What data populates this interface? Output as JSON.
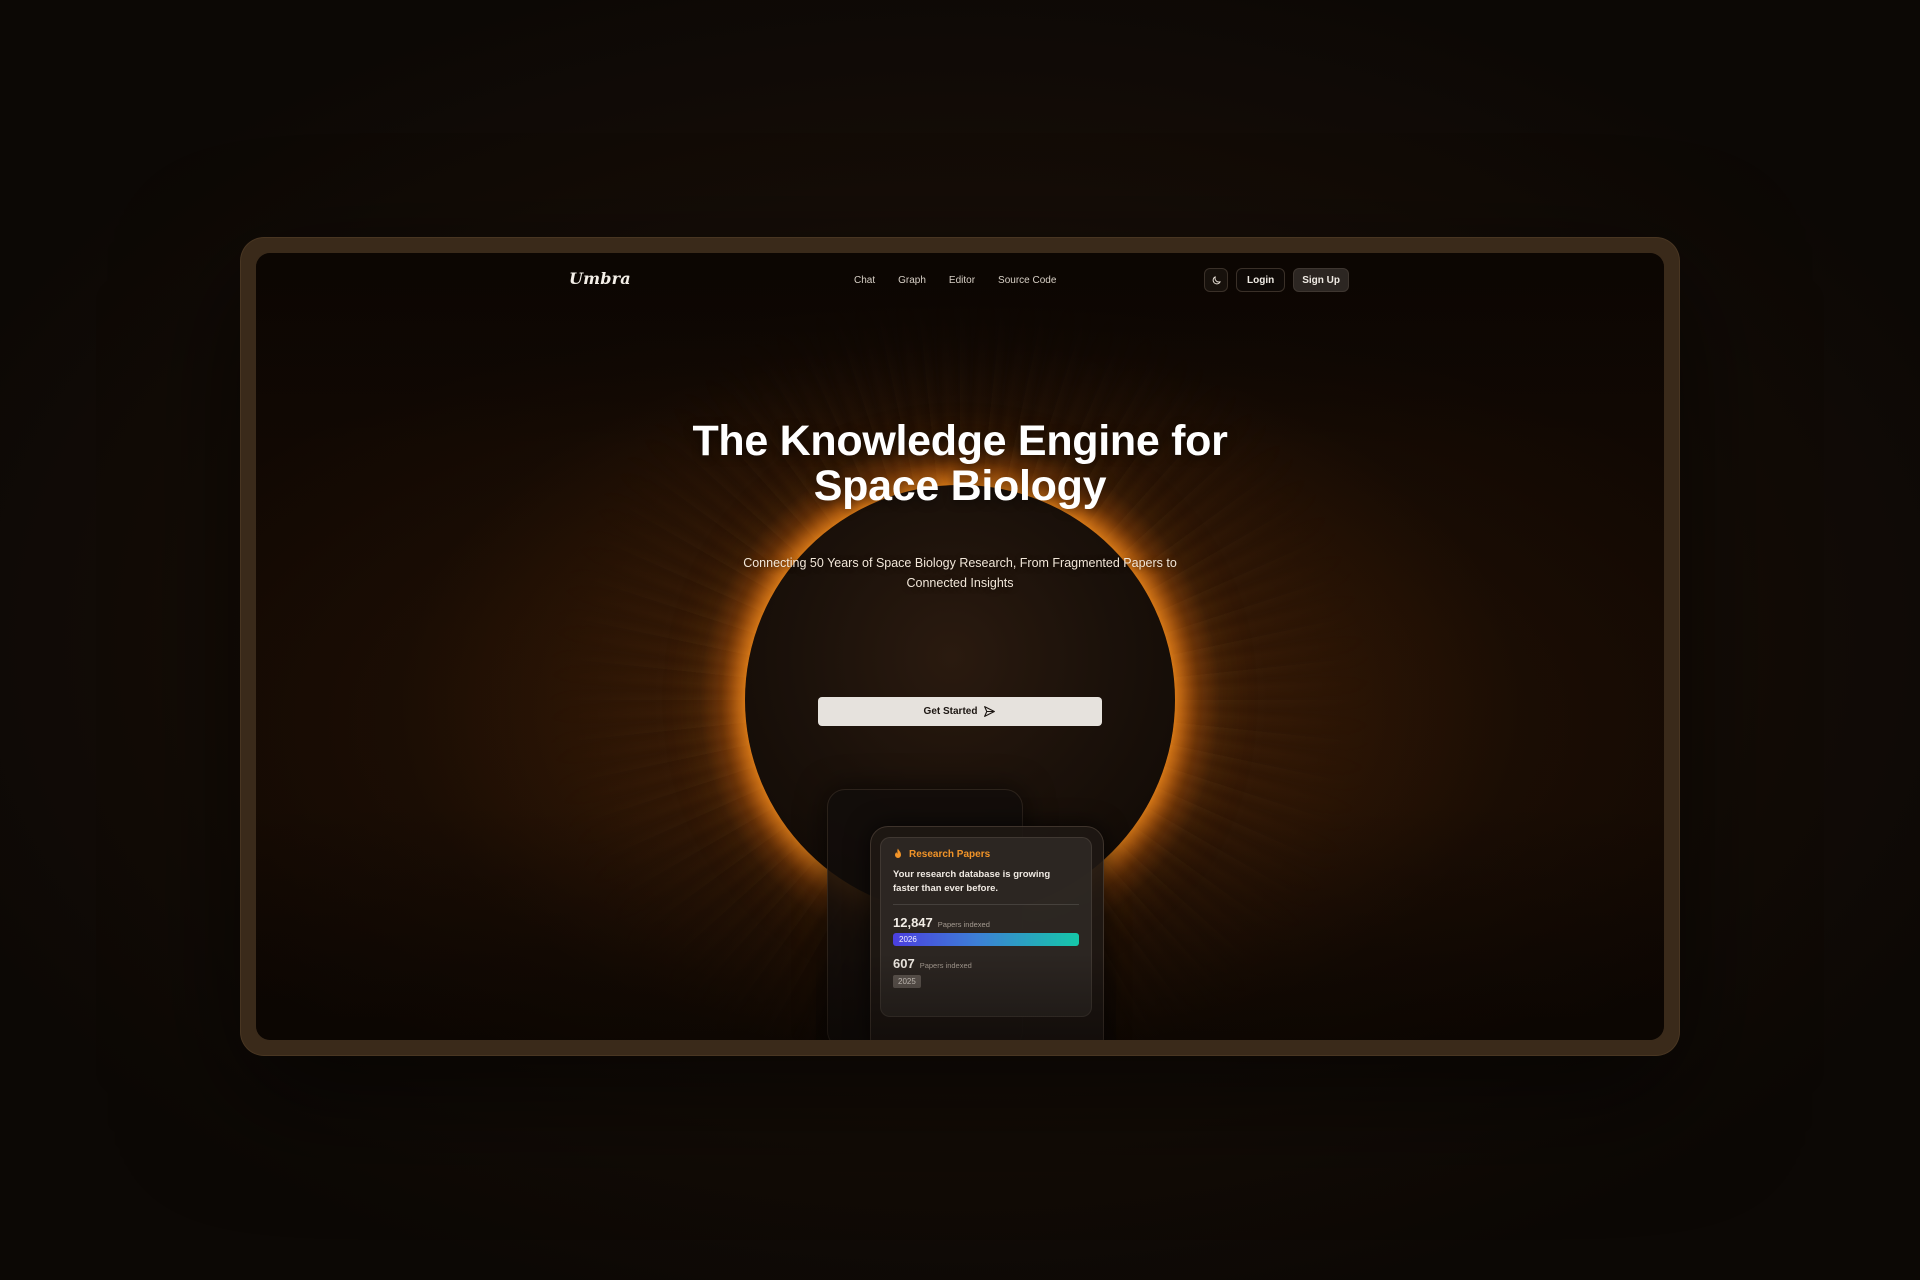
{
  "nav": {
    "logo": "Umbra",
    "links": [
      "Chat",
      "Graph",
      "Editor",
      "Source Code"
    ],
    "theme_toggle_icon": "moon-icon",
    "login_label": "Login",
    "signup_label": "Sign Up"
  },
  "hero": {
    "title_line1": "The Knowledge Engine for",
    "title_line2": "Space Biology",
    "subtitle_line1": "Connecting 50 Years of Space Biology Research, From Fragmented Papers to",
    "subtitle_line2": "Connected Insights",
    "cta_label": "Get Started",
    "cta_icon": "send-icon"
  },
  "card": {
    "icon": "flame-icon",
    "title": "Research Papers",
    "description": "Your research database is growing faster than ever before.",
    "stats": [
      {
        "value": "12,847",
        "label": "Papers indexed",
        "year": "2026"
      },
      {
        "value": "607",
        "label": "Papers indexed",
        "year": "2025"
      }
    ]
  },
  "colors": {
    "accent_orange": "#f29428",
    "bar_gradient_start": "#4b3fe0",
    "bar_gradient_end": "#15c7a8",
    "cta_bg": "#e6e2dd"
  }
}
